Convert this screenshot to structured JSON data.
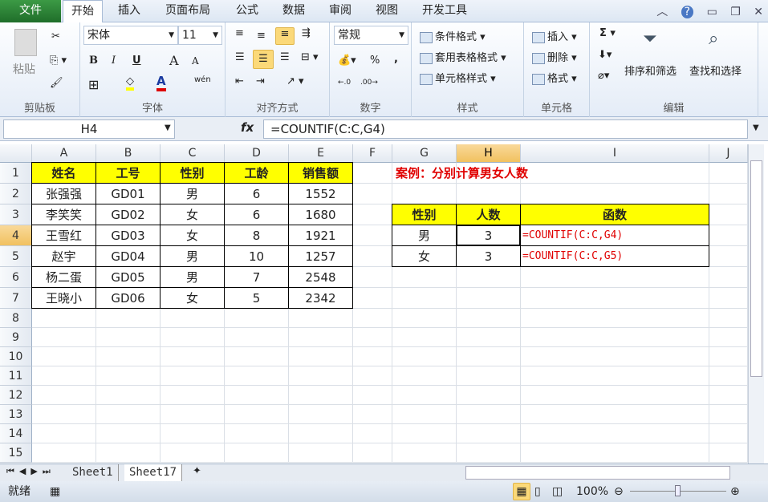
{
  "tabs": [
    "文件",
    "开始",
    "插入",
    "页面布局",
    "公式",
    "数据",
    "审阅",
    "视图",
    "开发工具"
  ],
  "active_tab": 1,
  "ribbon": {
    "clipboard": {
      "paste": "粘贴",
      "label": "剪贴板"
    },
    "font": {
      "name": "宋体",
      "size": "11",
      "label": "字体",
      "bold": "B",
      "italic": "I",
      "underline": "U",
      "grow": "A",
      "shrink": "A",
      "fill_color": "#ffff00",
      "font_color": "#e00000",
      "phonetic": "wén"
    },
    "alignment": {
      "label": "对齐方式"
    },
    "number": {
      "format": "常规",
      "percent": "%",
      "comma": ",",
      "label": "数字"
    },
    "styles": {
      "conditional": "条件格式",
      "table": "套用表格格式",
      "cell": "单元格样式",
      "label": "样式"
    },
    "cells": {
      "insert": "插入",
      "delete": "删除",
      "format": "格式",
      "label": "单元格"
    },
    "editing": {
      "sum": "Σ",
      "sort": "排序和筛选",
      "find": "查找和选择",
      "label": "编辑"
    }
  },
  "formula_bar": {
    "name_box": "H4",
    "fx": "fx",
    "formula": "=COUNTIF(C:C,G4)"
  },
  "columns": [
    "A",
    "B",
    "C",
    "D",
    "E",
    "F",
    "G",
    "H",
    "I",
    "J"
  ],
  "selected_column": "H",
  "row_numbers": [
    "1",
    "2",
    "3",
    "4",
    "5",
    "6",
    "7",
    "8",
    "9",
    "10",
    "11",
    "12",
    "13",
    "14",
    "15"
  ],
  "selected_row": "4",
  "table1": {
    "headers": [
      "姓名",
      "工号",
      "性别",
      "工龄",
      "销售额"
    ],
    "rows": [
      [
        "张强强",
        "GD01",
        "男",
        "6",
        "1552"
      ],
      [
        "李笑笑",
        "GD02",
        "女",
        "6",
        "1680"
      ],
      [
        "王雪红",
        "GD03",
        "女",
        "8",
        "1921"
      ],
      [
        "赵宇",
        "GD04",
        "男",
        "10",
        "1257"
      ],
      [
        "杨二蛋",
        "GD05",
        "男",
        "7",
        "2548"
      ],
      [
        "王晓小",
        "GD06",
        "女",
        "5",
        "2342"
      ]
    ]
  },
  "case_title": "案例：分别计算男女人数",
  "table2": {
    "headers": [
      "性别",
      "人数",
      "函数"
    ],
    "rows": [
      [
        "男",
        "3",
        "=COUNTIF(C:C,G4)"
      ],
      [
        "女",
        "3",
        "=COUNTIF(C:C,G5)"
      ]
    ]
  },
  "sheets": [
    "Sheet1",
    "Sheet17"
  ],
  "active_sheet": 1,
  "status": {
    "ready": "就绪",
    "zoom": "100%",
    "zoom_level": 100
  }
}
